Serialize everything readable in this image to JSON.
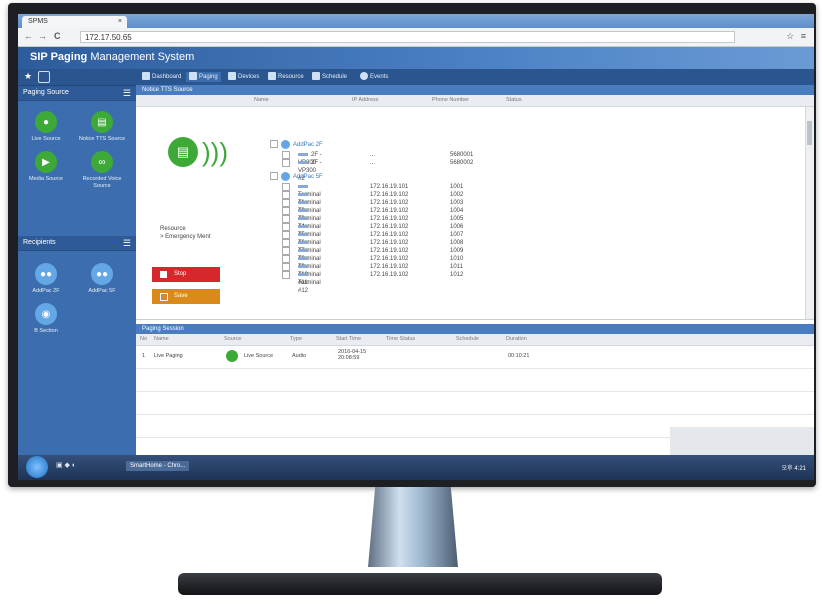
{
  "browser": {
    "tab_title": "SPMS",
    "tab_close": "×",
    "back": "←",
    "forward": "→",
    "reload": "C",
    "url": "172.17.50.65",
    "toolbar_icons": "☆ ≡"
  },
  "app": {
    "title_bold": "SIP Paging",
    "title_rest": " Management System"
  },
  "nav": {
    "tabs": [
      {
        "label": "Dashboard"
      },
      {
        "label": "Paging"
      },
      {
        "label": "Devices"
      },
      {
        "label": "Resource"
      },
      {
        "label": "Schedule"
      },
      {
        "label": "Events"
      }
    ]
  },
  "sidebar": {
    "paging_source_header": "Paging Source",
    "sources": [
      {
        "label": "Live Source",
        "icon": "microphone-icon"
      },
      {
        "label": "Notice TTS Source",
        "icon": "document-icon"
      },
      {
        "label": "Media Source",
        "icon": "play-icon"
      },
      {
        "label": "Recorded Voice Source",
        "icon": "voicemail-icon"
      }
    ],
    "recipients_header": "Recipients",
    "recipients": [
      {
        "label": "AddPac 2F"
      },
      {
        "label": "AddPac 5F"
      },
      {
        "label": "B Section"
      }
    ]
  },
  "tts_panel": {
    "header": "Notice TTS Source",
    "columns": [
      "Name",
      "IP Address",
      "Phone Number",
      "Status"
    ],
    "resource_label": "Resource",
    "resource_value": "> Emergency Ment",
    "stop_label": "Stop",
    "save_label": "Save"
  },
  "tree": {
    "group1": {
      "name": "AddPac 2F",
      "rows": [
        {
          "name": "2F - VP300",
          "ip": "...",
          "phone": "5680001"
        },
        {
          "name": "2F - VP300 #2",
          "ip": "...",
          "phone": "5680002"
        }
      ]
    },
    "group2": {
      "name": "AddPac 5F",
      "rows": [
        {
          "name": "Terminal #1",
          "ip": "172.16.19.101",
          "phone": "1001"
        },
        {
          "name": "Terminal #2",
          "ip": "172.16.19.102",
          "phone": "1002"
        },
        {
          "name": "Terminal #3",
          "ip": "172.16.19.102",
          "phone": "1003"
        },
        {
          "name": "Terminal #4",
          "ip": "172.16.19.102",
          "phone": "1004"
        },
        {
          "name": "Terminal #5",
          "ip": "172.16.19.102",
          "phone": "1005"
        },
        {
          "name": "Terminal #6",
          "ip": "172.16.19.102",
          "phone": "1006"
        },
        {
          "name": "Terminal #7",
          "ip": "172.16.19.102",
          "phone": "1007"
        },
        {
          "name": "Terminal #8",
          "ip": "172.16.19.102",
          "phone": "1008"
        },
        {
          "name": "Terminal #9",
          "ip": "172.16.19.102",
          "phone": "1009"
        },
        {
          "name": "Terminal #10",
          "ip": "172.16.19.102",
          "phone": "1010"
        },
        {
          "name": "Terminal #11",
          "ip": "172.16.19.102",
          "phone": "1011"
        },
        {
          "name": "Terminal #12",
          "ip": "172.16.19.102",
          "phone": "1012"
        }
      ]
    }
  },
  "session": {
    "header": "Paging Session",
    "columns": [
      "No",
      "Name",
      "Source",
      "Type",
      "Start Time",
      "Time Status",
      "Schedule",
      "Duration"
    ],
    "rows": [
      {
        "no": "1",
        "name": "Live Paging",
        "source": "Live Source",
        "type": "Audio",
        "start_date": "2016-04-15",
        "start_time": "20:08:59",
        "duration": "00:10:21"
      }
    ]
  },
  "taskbar": {
    "app_label": "SmartHome - Chro...",
    "clock": "오후 4:21"
  },
  "colors": {
    "accent_blue": "#3c6eaf",
    "green": "#3daa38",
    "stop_red": "#d6272d",
    "save_orange": "#d98a1b"
  }
}
